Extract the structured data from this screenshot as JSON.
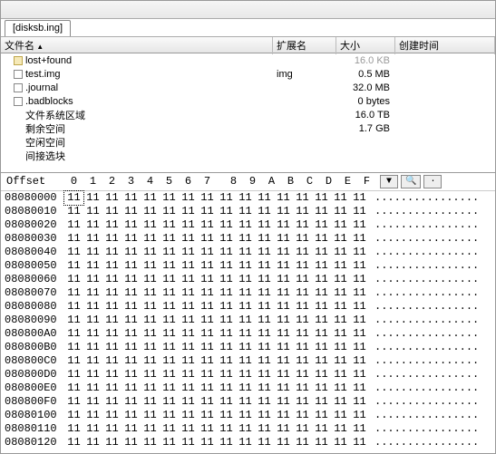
{
  "window": {
    "title_placeholder": ""
  },
  "tab": {
    "label": "[disksb.ing]"
  },
  "file_header": {
    "name": "文件名",
    "ext": "扩展名",
    "size": "大小",
    "date": "创建时间"
  },
  "files": [
    {
      "icon": "folder",
      "name": "lost+found",
      "ext": "",
      "size": "16.0 KB",
      "size_dim": true
    },
    {
      "icon": "file",
      "name": "test.img",
      "ext": "img",
      "size": "0.5 MB",
      "size_dim": false
    },
    {
      "icon": "file",
      "name": ".journal",
      "ext": "",
      "size": "32.0 MB",
      "size_dim": false
    },
    {
      "icon": "file",
      "name": ".badblocks",
      "ext": "",
      "size": "0 bytes",
      "size_dim": false
    },
    {
      "icon": "none",
      "name": "文件系统区域",
      "ext": "",
      "size": "16.0 TB",
      "size_dim": false
    },
    {
      "icon": "none",
      "name": "剩余空间",
      "ext": "",
      "size": "1.7 GB",
      "size_dim": false
    },
    {
      "icon": "none",
      "name": "空闲空间",
      "ext": "",
      "size": "",
      "size_dim": false
    },
    {
      "icon": "none",
      "name": "间接选块",
      "ext": "",
      "size": "",
      "size_dim": false
    }
  ],
  "hex": {
    "offset_label": "Offset",
    "cols": [
      "0",
      "1",
      "2",
      "3",
      "4",
      "5",
      "6",
      "7",
      "8",
      "9",
      "A",
      "B",
      "C",
      "D",
      "E",
      "F"
    ],
    "ascii_placeholder": "................",
    "byte_value": "11",
    "tools": {
      "down": "▼",
      "search": "🔍",
      "blank": "·"
    },
    "row_offsets": [
      "08080000",
      "08080010",
      "08080020",
      "08080030",
      "08080040",
      "08080050",
      "08080060",
      "08080070",
      "08080080",
      "08080090",
      "080800A0",
      "080800B0",
      "080800C0",
      "080800D0",
      "080800E0",
      "080800F0",
      "08080100",
      "08080110",
      "08080120"
    ]
  }
}
